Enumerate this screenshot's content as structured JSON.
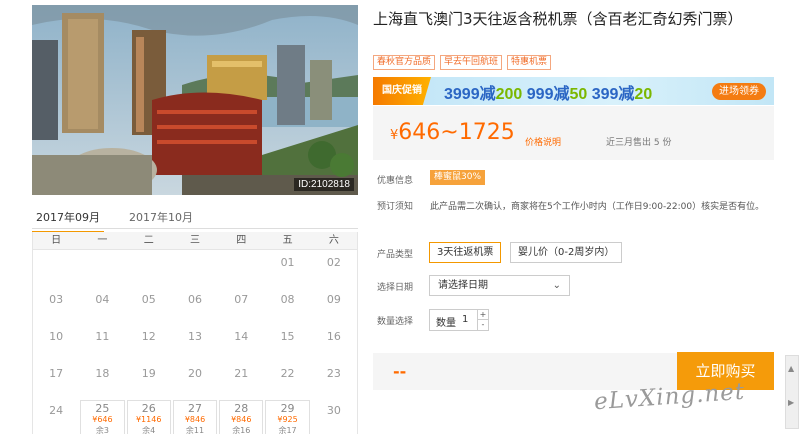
{
  "product": {
    "title": "上海直飞澳门3天往返含税机票（含百老汇奇幻秀门票）",
    "image_id": "ID:2102818",
    "tags": [
      "春秋官方品质",
      "早去午回航班",
      "特惠机票"
    ]
  },
  "promo": {
    "badge": "国庆促销",
    "offers": [
      {
        "threshold": "3999减",
        "amount": "200"
      },
      {
        "threshold": "999减",
        "amount": "50"
      },
      {
        "threshold": "399减",
        "amount": "20"
      }
    ],
    "button": "进场领券"
  },
  "price": {
    "currency": "¥",
    "range": "646~1725",
    "explain": "价格说明",
    "sold": "近三月售出 5 份"
  },
  "info": {
    "discount_label": "优惠信息",
    "discount_badge": "棒蜜鼠30%",
    "notice_label": "预订须知",
    "notice_text": "此产品需二次确认，商家将在5个工作小时内（工作日9:00-22:00）核实是否有位。"
  },
  "options": {
    "type_label": "产品类型",
    "types": [
      "3天往返机票",
      "婴儿价（0-2周岁内）"
    ],
    "date_label": "选择日期",
    "date_placeholder": "请选择日期",
    "qty_label": "数量选择",
    "qty_inner_label": "数量",
    "qty_value": "1",
    "qty_up": "+",
    "qty_down": "-"
  },
  "buy": {
    "price_placeholder": "--",
    "button": "立即购买"
  },
  "calendar": {
    "months": [
      "2017年09月",
      "2017年10月"
    ],
    "weekdays": [
      "日",
      "一",
      "二",
      "三",
      "四",
      "五",
      "六"
    ],
    "rows": [
      [
        {
          "d": ""
        },
        {
          "d": ""
        },
        {
          "d": ""
        },
        {
          "d": ""
        },
        {
          "d": ""
        },
        {
          "d": "01"
        },
        {
          "d": "02"
        }
      ],
      [
        {
          "d": "03"
        },
        {
          "d": "04"
        },
        {
          "d": "05"
        },
        {
          "d": "06"
        },
        {
          "d": "07"
        },
        {
          "d": "08"
        },
        {
          "d": "09"
        }
      ],
      [
        {
          "d": "10"
        },
        {
          "d": "11"
        },
        {
          "d": "12"
        },
        {
          "d": "13"
        },
        {
          "d": "14"
        },
        {
          "d": "15"
        },
        {
          "d": "16"
        }
      ],
      [
        {
          "d": "17"
        },
        {
          "d": "18"
        },
        {
          "d": "19"
        },
        {
          "d": "20"
        },
        {
          "d": "21"
        },
        {
          "d": "22"
        },
        {
          "d": "23"
        }
      ],
      [
        {
          "d": "24"
        },
        {
          "d": "25",
          "price": "¥646",
          "left": "余3"
        },
        {
          "d": "26",
          "price": "¥1146",
          "left": "余4"
        },
        {
          "d": "27",
          "price": "¥846",
          "left": "余11"
        },
        {
          "d": "28",
          "price": "¥846",
          "left": "余16"
        },
        {
          "d": "29",
          "price": "¥925",
          "left": "余17"
        },
        {
          "d": "30"
        }
      ]
    ]
  },
  "watermark": "eLvXing.net"
}
